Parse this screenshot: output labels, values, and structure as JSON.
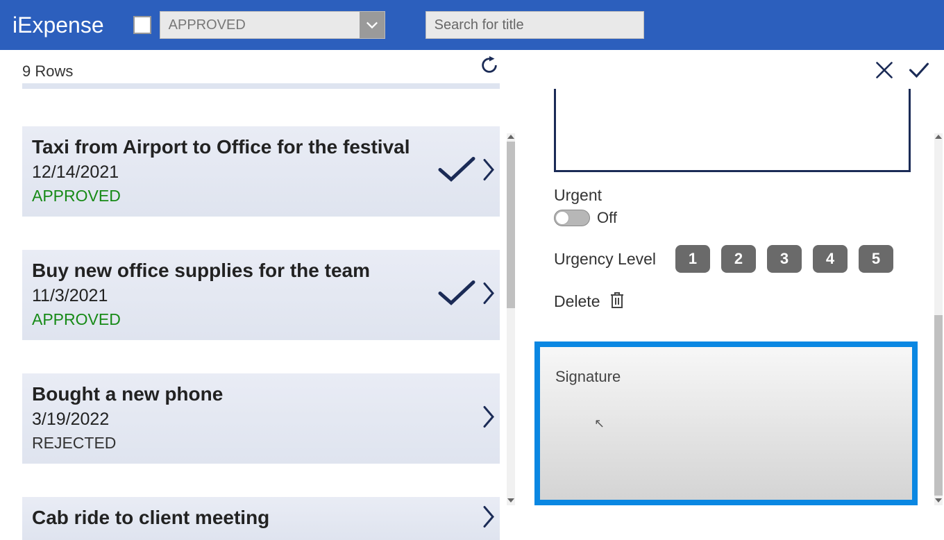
{
  "header": {
    "app_title": "iExpense",
    "status_filter": "APPROVED",
    "search_placeholder": "Search for title"
  },
  "list": {
    "rows_label": "9 Rows",
    "items": [
      {
        "title": "Taxi from Airport to Office for the festival",
        "date": "12/14/2021",
        "status": "APPROVED",
        "status_class": "status-approved",
        "show_check": true
      },
      {
        "title": "Buy new office supplies for the team",
        "date": "11/3/2021",
        "status": "APPROVED",
        "status_class": "status-approved",
        "show_check": true
      },
      {
        "title": "Bought a new phone",
        "date": "3/19/2022",
        "status": "REJECTED",
        "status_class": "status-rejected",
        "show_check": false
      },
      {
        "title": "Cab ride to client meeting",
        "date": "",
        "status": "",
        "status_class": "",
        "show_check": false
      }
    ]
  },
  "detail": {
    "urgent_label": "Urgent",
    "toggle_state": "Off",
    "urgency_label": "Urgency Level",
    "levels": [
      "1",
      "2",
      "3",
      "4",
      "5"
    ],
    "delete_label": "Delete",
    "signature_label": "Signature"
  },
  "colors": {
    "accent": "#2c5fbd",
    "highlight": "#0a87e2",
    "approved": "#178a17"
  }
}
